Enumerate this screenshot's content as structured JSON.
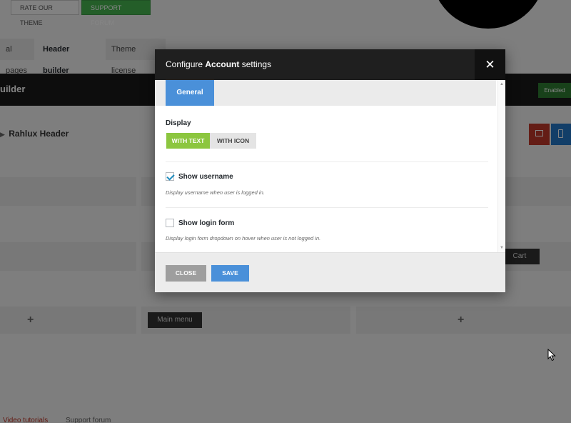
{
  "background": {
    "top_buttons": {
      "rate": "RATE OUR THEME",
      "support": "SUPPORT FORUM"
    },
    "tabs": [
      "al pages",
      "Header builder",
      "Theme license"
    ],
    "builder_title": "uilder",
    "enabled_badge": "Enabled",
    "header_name": "Rahlux Header",
    "cart_label": "Cart",
    "main_menu_label": "Main menu",
    "plus": "+",
    "footer_links": [
      "Video tutorials",
      "Support forum"
    ]
  },
  "modal": {
    "title_prefix": "Configure ",
    "title_strong": "Account",
    "title_suffix": " settings",
    "close_glyph": "✕",
    "tabs": [
      "General"
    ],
    "display_label": "Display",
    "display_options": [
      "WITH TEXT",
      "WITH ICON"
    ],
    "display_selected": "WITH TEXT",
    "options": [
      {
        "label": "Show username",
        "checked": true,
        "help": "Display username when user is logged in."
      },
      {
        "label": "Show login form",
        "checked": false,
        "help": "Display login form dropdown on hover when user is not logged in."
      }
    ],
    "buttons": {
      "close": "CLOSE",
      "save": "SAVE"
    }
  },
  "colors": {
    "accent_blue": "#4a90d9",
    "active_green": "#8cc63f",
    "header_dark": "#1f1f1f",
    "support_green": "#46b450"
  }
}
